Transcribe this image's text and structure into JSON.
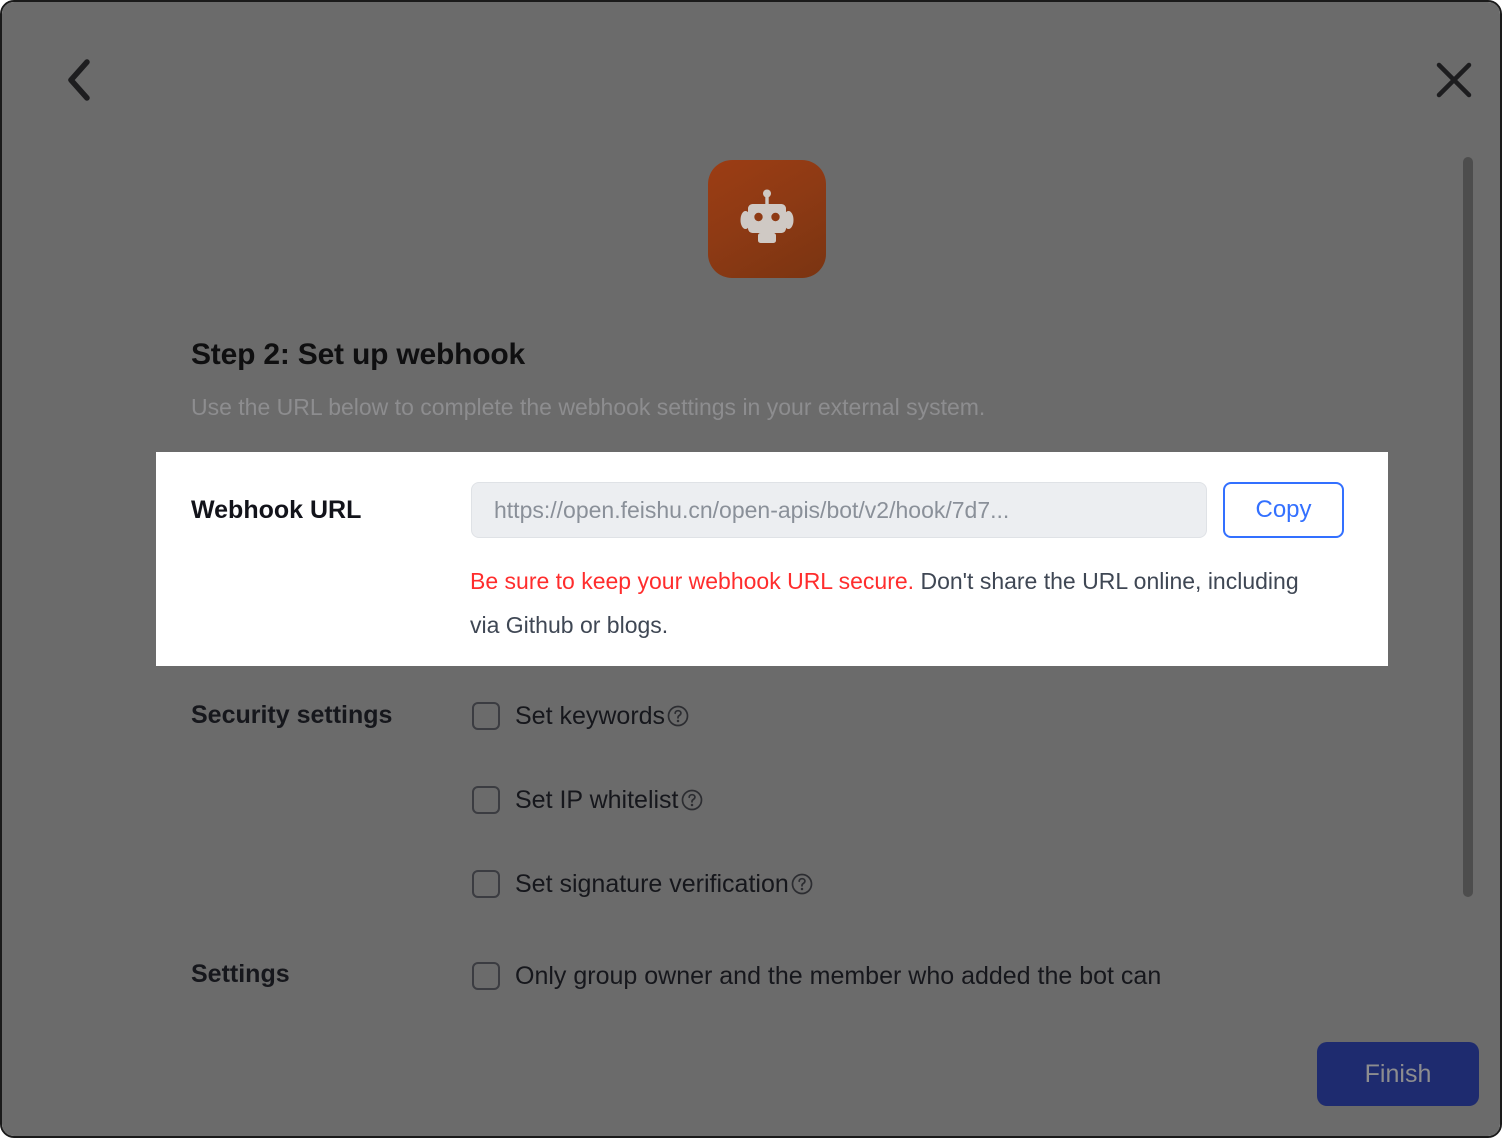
{
  "window": {
    "overlay_color": "#6b6b6b",
    "accent_blue": "#3370ff",
    "warning_red": "#ff2d2d",
    "finish_bg": "#1e2b6f"
  },
  "topbar": {
    "back_icon": "chevron-left-icon",
    "close_icon": "close-icon"
  },
  "avatar": {
    "icon": "robot-icon",
    "background": "#8e3a14"
  },
  "header": {
    "title": "Step 2: Set up webhook",
    "subtitle": "Use the URL below to complete the webhook settings in your external system."
  },
  "webhook": {
    "label": "Webhook URL",
    "url_value": "https://open.feishu.cn/open-apis/bot/v2/hook/7d7...",
    "url_placeholder": "https://open.feishu.cn/open-apis/bot/v2/hook/7d7...",
    "copy_label": "Copy",
    "warning_red": "Be sure to keep your webhook URL secure.",
    "warning_rest": " Don't share the URL online, including via Github or blogs."
  },
  "security": {
    "label": "Security settings",
    "options": [
      {
        "label": "Set keywords",
        "checked": false,
        "help_icon": "help-circle-icon"
      },
      {
        "label": "Set IP whitelist",
        "checked": false,
        "help_icon": "help-circle-icon"
      },
      {
        "label": "Set signature verification",
        "checked": false,
        "help_icon": "help-circle-icon"
      }
    ]
  },
  "settings": {
    "label": "Settings",
    "options": [
      {
        "label": "Only group owner and the member who added the bot can",
        "checked": false
      }
    ]
  },
  "footer": {
    "finish_label": "Finish"
  },
  "scrollbar": {
    "orientation": "vertical",
    "thumb_color": "#4d4d4d"
  }
}
